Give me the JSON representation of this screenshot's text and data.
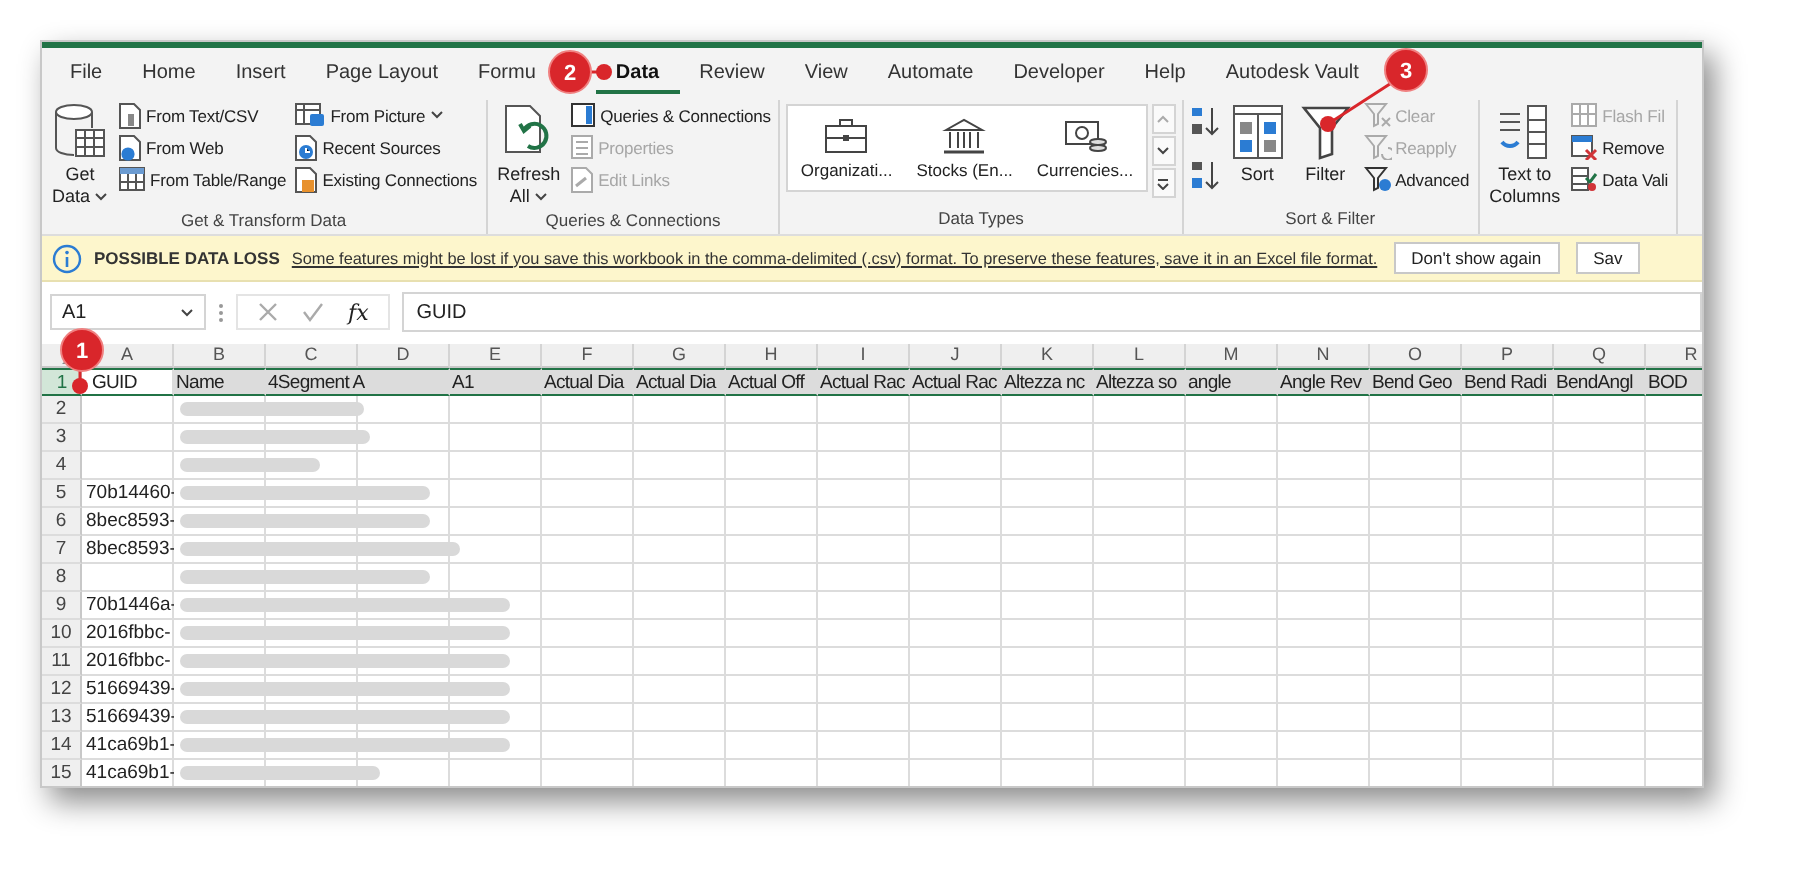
{
  "menu_tabs": [
    {
      "label": "File",
      "selected": false
    },
    {
      "label": "Home",
      "selected": false
    },
    {
      "label": "Insert",
      "selected": false
    },
    {
      "label": "Page Layout",
      "selected": false
    },
    {
      "label": "Formu",
      "selected": false
    },
    {
      "label": "Data",
      "selected": true
    },
    {
      "label": "Review",
      "selected": false
    },
    {
      "label": "View",
      "selected": false
    },
    {
      "label": "Automate",
      "selected": false
    },
    {
      "label": "Developer",
      "selected": false
    },
    {
      "label": "Help",
      "selected": false
    },
    {
      "label": "Autodesk Vault",
      "selected": false
    }
  ],
  "ribbon_groups": [
    {
      "kind": "get_transform",
      "label": "Get & Transform Data",
      "large_buttons": [
        {
          "lines": [
            "Get",
            "Data"
          ],
          "dropdown": true,
          "disabled": false
        }
      ],
      "small_buttons": [
        {
          "label": "From Text/CSV",
          "disabled": false
        },
        {
          "label": "From Web",
          "disabled": false
        },
        {
          "label": "From Table/Range",
          "disabled": false
        },
        {
          "label": "From Picture",
          "dropdown": true,
          "disabled": false
        },
        {
          "label": "Recent Sources",
          "disabled": false
        },
        {
          "label": "Existing Connections",
          "disabled": false
        }
      ]
    },
    {
      "kind": "queries",
      "label": "Queries & Connections",
      "large_buttons": [
        {
          "lines": [
            "Refresh",
            "All"
          ],
          "dropdown": true,
          "disabled": false
        }
      ],
      "small_buttons": [
        {
          "label": "Queries & Connections",
          "disabled": false
        },
        {
          "label": "Properties",
          "disabled": true
        },
        {
          "label": "Edit Links",
          "disabled": true
        }
      ]
    },
    {
      "kind": "data_types",
      "label": "Data Types",
      "gallery": [
        {
          "label": "Organizati..."
        },
        {
          "label": "Stocks (En..."
        },
        {
          "label": "Currencies..."
        }
      ]
    },
    {
      "kind": "sort_filter",
      "label": "Sort & Filter",
      "large_buttons": [
        {
          "lines": [
            "Sort"
          ],
          "disabled": false
        },
        {
          "lines": [
            "Filter"
          ],
          "disabled": false
        }
      ],
      "small_buttons": [
        {
          "label": "Clear",
          "disabled": true
        },
        {
          "label": "Reapply",
          "disabled": true
        },
        {
          "label": "Advanced",
          "disabled": false
        }
      ]
    },
    {
      "kind": "data_tools",
      "large_buttons": [
        {
          "lines": [
            "Text to",
            "Columns"
          ],
          "disabled": false
        }
      ],
      "small_buttons": [
        {
          "label": "Flash Fil",
          "disabled": true
        },
        {
          "label": "Remove",
          "disabled": false
        },
        {
          "label": "Data Vali",
          "disabled": false
        }
      ]
    }
  ],
  "message_bar": {
    "title": "POSSIBLE DATA LOSS",
    "message": "Some features might be lost if you save this workbook in the comma-delimited (.csv) format. To preserve these features, save it in an Excel file format.",
    "buttons": [
      "Don't show again",
      "Sav"
    ]
  },
  "formula_bar": {
    "name_box": "A1",
    "function_button": "fx",
    "value": "GUID"
  },
  "sheet": {
    "columns": [
      "A",
      "B",
      "C",
      "D",
      "E",
      "F",
      "G",
      "H",
      "I",
      "J",
      "K",
      "L",
      "M",
      "N",
      "O",
      "P",
      "Q",
      "R"
    ],
    "rows": [
      {
        "number": "1",
        "selected": true,
        "cells": [
          "GUID",
          "Name",
          "4Segment A",
          null,
          "A1",
          "Actual Dia",
          "Actual Dia",
          "Actual Off",
          "Actual Rac",
          "Actual Rac",
          "Altezza nc",
          "Altezza so",
          "angle",
          "Angle Rev",
          "Bend Geo",
          "Bend Radi",
          "BendAngl",
          "BOD"
        ]
      },
      {
        "number": "2",
        "selected": false,
        "cells": [],
        "blurred_name": true
      },
      {
        "number": "3",
        "selected": false,
        "cells": [],
        "blurred_name": true
      },
      {
        "number": "4",
        "selected": false,
        "cells": [],
        "blurred_name": true
      },
      {
        "number": "5",
        "selected": false,
        "cells": [
          "70b14460-"
        ],
        "blurred_name": true
      },
      {
        "number": "6",
        "selected": false,
        "cells": [
          "8bec8593-"
        ],
        "blurred_name": true
      },
      {
        "number": "7",
        "selected": false,
        "cells": [
          "8bec8593-"
        ],
        "blurred_name": true
      },
      {
        "number": "8",
        "selected": false,
        "cells": [],
        "blurred_name": true
      },
      {
        "number": "9",
        "selected": false,
        "cells": [
          "70b1446a-"
        ],
        "blurred_name": true
      },
      {
        "number": "10",
        "selected": false,
        "cells": [
          "2016fbbc-"
        ],
        "blurred_name": true
      },
      {
        "number": "11",
        "selected": false,
        "cells": [
          "2016fbbc-"
        ],
        "blurred_name": true
      },
      {
        "number": "12",
        "selected": false,
        "cells": [
          "51669439-"
        ],
        "blurred_name": true
      },
      {
        "number": "13",
        "selected": false,
        "cells": [
          "51669439-"
        ],
        "blurred_name": true
      },
      {
        "number": "14",
        "selected": false,
        "cells": [
          "41ca69b1-"
        ],
        "blurred_name": true
      },
      {
        "number": "15",
        "selected": false,
        "cells": [
          "41ca69b1-"
        ],
        "blurred_name": true
      }
    ]
  },
  "callouts": [
    {
      "label": "1"
    },
    {
      "label": "2"
    },
    {
      "label": "3"
    }
  ]
}
